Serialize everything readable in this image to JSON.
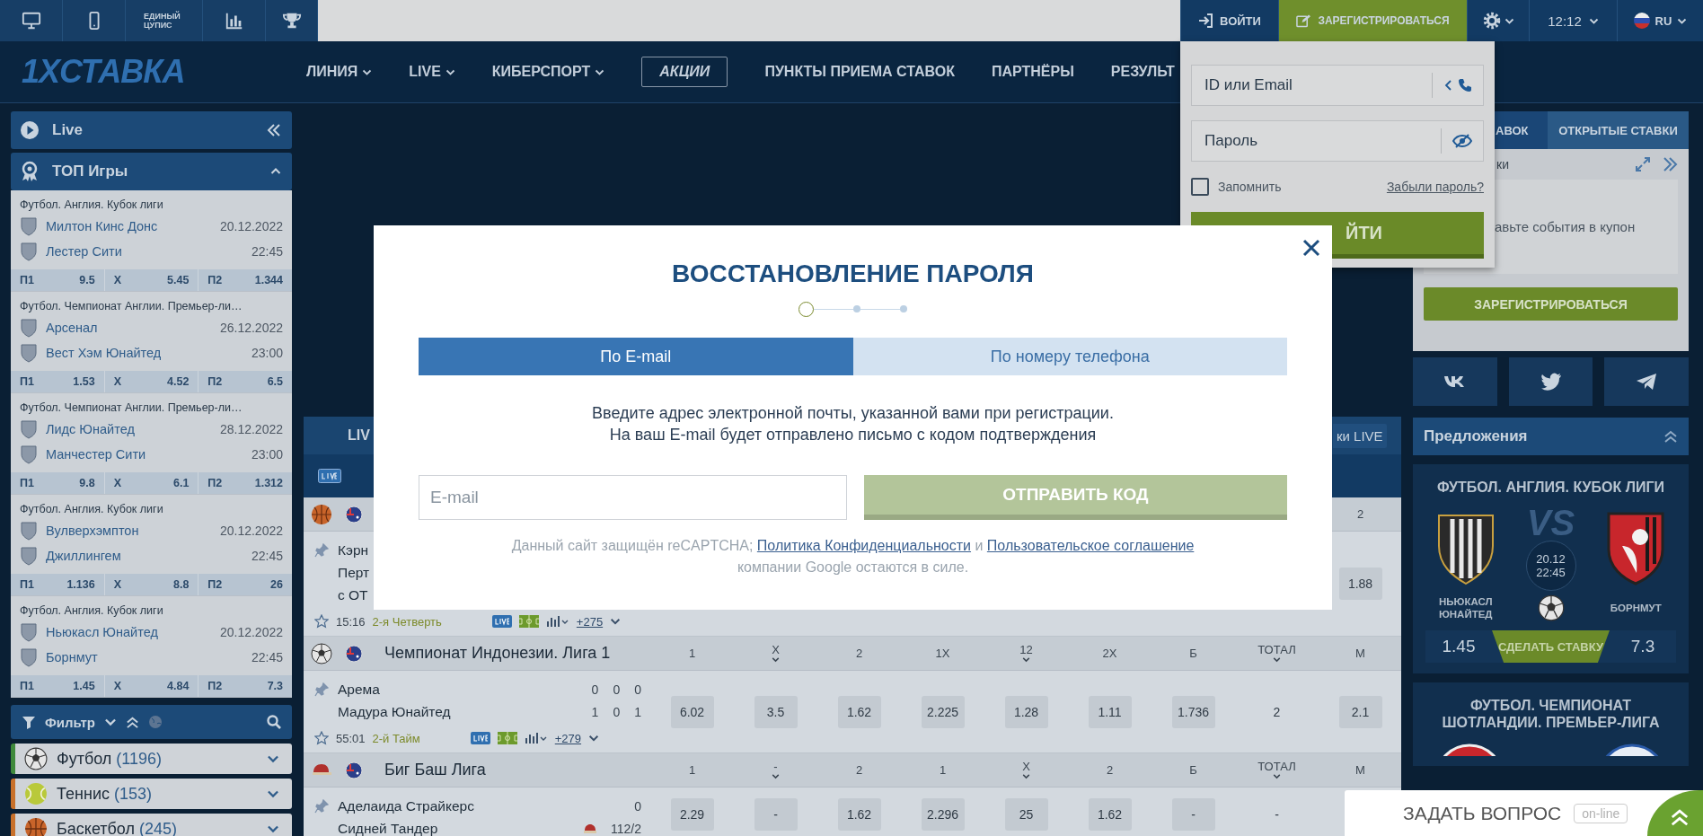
{
  "topbar": {
    "cupis_lines": [
      "ЕДИНЫЙ",
      "ЦУПИС"
    ],
    "login": "ВОЙТИ",
    "register": "ЗАРЕГИСТРИРОВАТЬСЯ",
    "time": "12:12",
    "language": "RU"
  },
  "nav": {
    "logo": "1XСТАВКА",
    "items": [
      {
        "label": "ЛИНИЯ",
        "kind": "dropdown"
      },
      {
        "label": "LIVE",
        "kind": "dropdown"
      },
      {
        "label": "КИБЕРСПОРТ",
        "kind": "dropdown"
      },
      {
        "label": "АКЦИИ",
        "kind": "boxed"
      },
      {
        "label": "ПУНКТЫ ПРИЕМА СТАВОК",
        "kind": "plain"
      },
      {
        "label": "ПАРТНЁРЫ",
        "kind": "plain"
      },
      {
        "label": "РЕЗУЛЬТ",
        "kind": "plain"
      }
    ]
  },
  "login_form": {
    "login_placeholder": "ID или Email",
    "password_placeholder": "Пароль",
    "remember": {
      "label": "Запомнить",
      "checked": false
    },
    "forgot": "Забыли пароль?",
    "submit": "ЙТИ"
  },
  "sidebar": {
    "live_label": "Live",
    "top_label": "ТОП Игры",
    "top_expanded": true,
    "matches": [
      {
        "league": "Футбол. Англия. Кубок лиги",
        "team1": "Милтон Кинс Донс",
        "team2": "Лестер Сити",
        "date": "20.12.2022",
        "time": "22:45",
        "odds": [
          {
            "label": "П1",
            "value": "9.5"
          },
          {
            "label": "X",
            "value": "5.45"
          },
          {
            "label": "П2",
            "value": "1.344"
          }
        ]
      },
      {
        "league": "Футбол. Чемпионат Англии. Премьер-ли…",
        "team1": "Арсенал",
        "team2": "Вест Хэм Юнайтед",
        "date": "26.12.2022",
        "time": "23:00",
        "odds": [
          {
            "label": "П1",
            "value": "1.53"
          },
          {
            "label": "X",
            "value": "4.52"
          },
          {
            "label": "П2",
            "value": "6.5"
          }
        ]
      },
      {
        "league": "Футбол. Чемпионат Англии. Премьер-ли…",
        "team1": "Лидс Юнайтед",
        "team2": "Манчестер Сити",
        "date": "28.12.2022",
        "time": "23:00",
        "odds": [
          {
            "label": "П1",
            "value": "9.8"
          },
          {
            "label": "X",
            "value": "6.1"
          },
          {
            "label": "П2",
            "value": "1.312"
          }
        ]
      },
      {
        "league": "Футбол. Англия. Кубок лиги",
        "team1": "Вулверхэмптон",
        "team2": "Джиллингем",
        "date": "20.12.2022",
        "time": "22:45",
        "odds": [
          {
            "label": "П1",
            "value": "1.136"
          },
          {
            "label": "X",
            "value": "8.8"
          },
          {
            "label": "П2",
            "value": "26"
          }
        ]
      },
      {
        "league": "Футбол. Англия. Кубок лиги",
        "team1": "Ньюкасл Юнайтед",
        "team2": "Борнмут",
        "date": "20.12.2022",
        "time": "22:45",
        "odds": [
          {
            "label": "П1",
            "value": "1.45"
          },
          {
            "label": "X",
            "value": "4.84"
          },
          {
            "label": "П2",
            "value": "7.3"
          }
        ]
      }
    ],
    "filter_label": "Фильтр",
    "sports": [
      {
        "name": "Футбол",
        "count": "(1196)",
        "kind": "football",
        "color": "#3f8a3c"
      },
      {
        "name": "Теннис",
        "count": "(153)",
        "kind": "tennis",
        "color": "#c8702a"
      },
      {
        "name": "Баскетбол",
        "count": "(245)",
        "kind": "basketball",
        "color": "#c8702a"
      }
    ]
  },
  "center": {
    "live_tab": "LIV",
    "live_link": "ки LIVE",
    "groups": [
      {
        "kind": "basketball",
        "columns": [
          {
            "label": "2",
            "menu": false,
            "kind": "odd"
          }
        ],
        "events": [
          {
            "teams": [
              {
                "name": "Кэрн"
              },
              {
                "name": "Перт"
              },
              {
                "name": "с ОТ"
              }
            ],
            "odds": [
              "1.88"
            ],
            "clock": "15:16",
            "period": "2-я Четверть",
            "markets": "+275"
          }
        ]
      },
      {
        "kind": "football",
        "title": "Чемпионат Индонезии. Лига 1",
        "columns": [
          {
            "label": "1",
            "menu": false,
            "kind": "odd"
          },
          {
            "label": "X",
            "menu": true,
            "kind": "odd"
          },
          {
            "label": "2",
            "menu": false,
            "kind": "odd"
          },
          {
            "label": "1X",
            "menu": false,
            "kind": "odd"
          },
          {
            "label": "12",
            "menu": true,
            "kind": "odd"
          },
          {
            "label": "2X",
            "menu": false,
            "kind": "odd"
          },
          {
            "label": "Б",
            "menu": false,
            "kind": "odd"
          },
          {
            "label": "ТОТАЛ",
            "menu": true,
            "kind": "param"
          },
          {
            "label": "М",
            "menu": false,
            "kind": "odd"
          }
        ],
        "events": [
          {
            "teams": [
              {
                "name": "Арема",
                "scores": [
                  "0",
                  "0",
                  "0"
                ],
                "batting": false
              },
              {
                "name": "Мадура Юнайтед",
                "scores": [
                  "1",
                  "0",
                  "1"
                ],
                "batting": false
              }
            ],
            "odds": [
              "6.02",
              "3.5",
              "1.62",
              "2.225",
              "1.28",
              "1.11",
              "1.736",
              "2",
              "2.1"
            ],
            "clock": "55:01",
            "period": "2-й Тайм",
            "markets": "+279"
          }
        ]
      },
      {
        "kind": "cricket",
        "title": "Биг Баш Лига",
        "columns": [
          {
            "label": "1",
            "menu": false,
            "kind": "odd"
          },
          {
            "label": "-",
            "menu": true,
            "kind": "odd"
          },
          {
            "label": "2",
            "menu": false,
            "kind": "odd"
          },
          {
            "label": "1",
            "menu": false,
            "kind": "odd"
          },
          {
            "label": "X",
            "menu": true,
            "kind": "odd"
          },
          {
            "label": "2",
            "menu": false,
            "kind": "odd"
          },
          {
            "label": "Б",
            "menu": false,
            "kind": "odd"
          },
          {
            "label": "ТОТАЛ",
            "menu": true,
            "kind": "param"
          },
          {
            "label": "М",
            "menu": false
          }
        ],
        "events": [
          {
            "teams": [
              {
                "name": "Аделаида Страйкерс",
                "scores": [
                  "0"
                ],
                "batting": false
              },
              {
                "name": "Сидней Тандер",
                "scores": [
                  "112/2"
                ],
                "batting": true
              }
            ],
            "odds": [
              "2.29",
              "-",
              "1.62",
              "2.296",
              "25",
              "1.62",
              "-",
              "-"
            ]
          }
        ]
      }
    ]
  },
  "bet_slip": {
    "tabs": [
      {
        "label": "АВОК",
        "selected": true
      },
      {
        "label": "ОТКРЫТЫЕ СТАВКИ",
        "selected": false
      }
    ],
    "title": "ки",
    "empty_text": "авьте события в купон",
    "register": "ЗАРЕГИСТРИРОВАТЬСЯ"
  },
  "offers": {
    "title": "Предложения",
    "cards": [
      {
        "league": "ФУТБОЛ. АНГЛИЯ. КУБОК ЛИГИ",
        "mark": "VS",
        "team1": "НЬЮКАСЛ ЮНАЙТЕД",
        "team2": "БОРНМУТ",
        "date": "20.12",
        "time": "22:45",
        "odd1": "1.45",
        "action": "СДЕЛАТЬ СТАВКУ",
        "odd2": "7.3"
      },
      {
        "league": "ФУТБОЛ. ЧЕМПИОНАТ ШОТЛАНДИИ. ПРЕМЬЕР-ЛИГА"
      }
    ]
  },
  "modal": {
    "title": "ВОССТАНОВЛЕНИЕ ПАРОЛЯ",
    "steps": [
      {
        "active": true
      },
      {
        "active": false
      },
      {
        "active": false
      }
    ],
    "tabs": [
      {
        "label": "По E-mail",
        "selected": true
      },
      {
        "label": "По номеру телефона",
        "selected": false
      }
    ],
    "instructions": [
      "Введите адрес электронной почты, указанной вами при регистрации.",
      "На ваш E-mail будет отправлено письмо с кодом подтверждения"
    ],
    "email_placeholder": "E-mail",
    "submit": "ОТПРАВИТЬ КОД",
    "submit_disabled": true,
    "notice": [
      {
        "kind": "text",
        "text": "Данный сайт защищён reCAPTCHA; "
      },
      {
        "kind": "link",
        "text": "Политика Конфиденциальности"
      },
      {
        "kind": "text",
        "text": " и "
      },
      {
        "kind": "link",
        "text": "Пользовательское соглашение"
      },
      {
        "kind": "text",
        "text": " компании Google остаются в силе."
      }
    ]
  },
  "chat": {
    "label": "ЗАДАТЬ ВОПРОС",
    "status": "on-line"
  }
}
